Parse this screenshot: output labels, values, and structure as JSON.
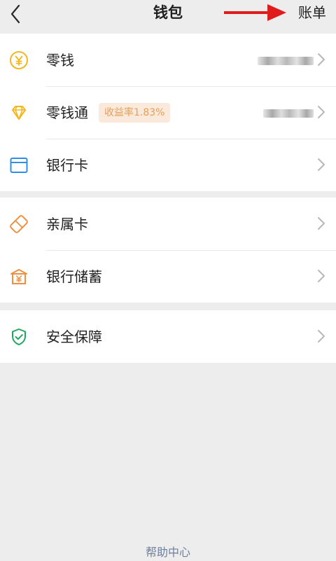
{
  "header": {
    "title": "钱包",
    "bill_label": "账单"
  },
  "wallet_items": [
    {
      "label": "零钱",
      "icon": "yuan-coin-icon"
    },
    {
      "label": "零钱通",
      "badge": "收益率1.83%",
      "icon": "diamond-icon"
    },
    {
      "label": "银行卡",
      "icon": "bank-card-icon"
    }
  ],
  "family_items": [
    {
      "label": "亲属卡",
      "icon": "family-card-icon"
    },
    {
      "label": "银行储蓄",
      "icon": "bank-savings-icon"
    }
  ],
  "security_items": [
    {
      "label": "安全保障",
      "icon": "shield-check-icon"
    }
  ],
  "footer": {
    "help_label": "帮助中心"
  },
  "colors": {
    "accent_yellow": "#f3b61d",
    "accent_blue": "#2f8fe8",
    "accent_orange": "#ef8f3f",
    "accent_green": "#1fa65e",
    "arrow_red": "#e01b1b",
    "link_blue": "#6e7f9c"
  }
}
